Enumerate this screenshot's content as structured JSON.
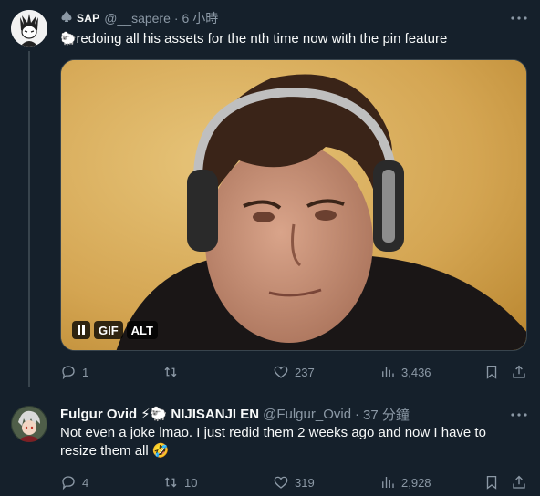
{
  "tweet1": {
    "display_name": "SAP",
    "handle": "@__sapere",
    "separator": "·",
    "time": "6 小時",
    "text": "redoing all his assets for the nth time now with the pin feature",
    "media": {
      "badges": [
        "GIF",
        "ALT"
      ]
    },
    "stats": {
      "replies": "1",
      "retweets": "",
      "likes": "237",
      "views": "3,436"
    }
  },
  "tweet2": {
    "display_name": "Fulgur Ovid",
    "org": "NIJISANJI EN",
    "handle": "@Fulgur_Ovid",
    "separator": "·",
    "time": "37 分鐘",
    "text": "Not even a joke lmao. I just redid them 2 weeks ago and now I have to resize them all",
    "stats": {
      "replies": "4",
      "retweets": "10",
      "likes": "319",
      "views": "2,928"
    }
  },
  "colors": {
    "background": "#15202b",
    "muted_text": "#8b98a5",
    "divider": "#38444d",
    "text": "#f7f9f9"
  }
}
